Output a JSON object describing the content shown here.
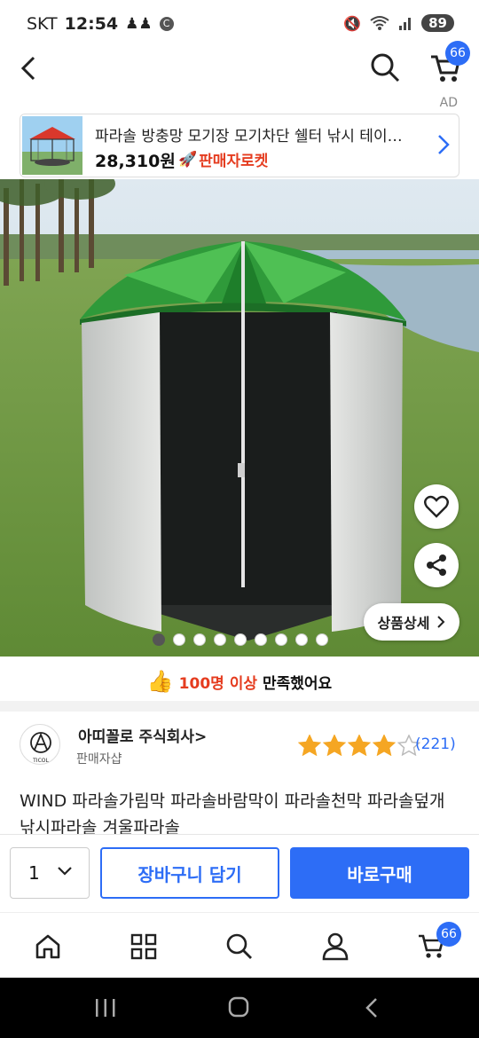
{
  "status_bar": {
    "carrier": "SKT",
    "time": "12:54",
    "battery": "89"
  },
  "app_bar": {
    "cart_count": "66"
  },
  "ad": {
    "label": "AD",
    "title": "파라솔 방충망 모기장 모기차단 쉘터 낚시 테이…",
    "price": "28,310원",
    "badge": "판매자로켓"
  },
  "product_image": {
    "detail_button": "상품상세",
    "slide_count": 9,
    "active_slide": 0
  },
  "satisfaction": {
    "highlight": "100명 이상",
    "rest": "만족했어요"
  },
  "seller": {
    "name": "아띠꼴로 주식회사",
    "sub": "판매자샵",
    "logo_text": "TICOL"
  },
  "rating": {
    "stars": 4,
    "review_count": "(221)"
  },
  "product_title": "WIND 파라솔가림막 파라솔바람막이 파라솔천막 파라솔덮개 낚시파라솔 겨울파라솔",
  "purchase_bar": {
    "quantity": "1",
    "cart_button": "장바구니 담기",
    "buy_button": "바로구매"
  },
  "bottom_nav": {
    "cart_count": "66"
  },
  "colors": {
    "accent": "#2d6df6",
    "rocket": "#e53c1f",
    "star": "#f5a623"
  }
}
